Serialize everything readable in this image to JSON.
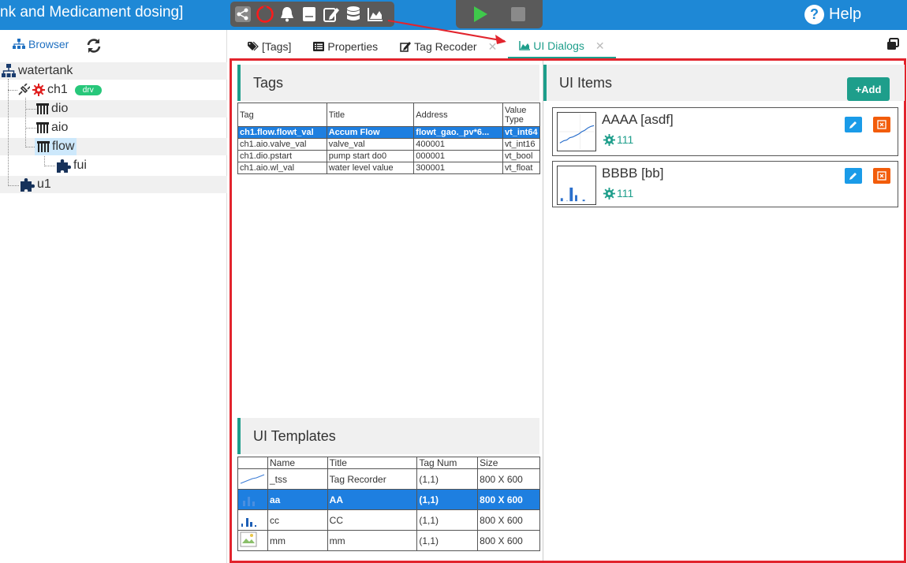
{
  "app": {
    "title": "nk and Medicament dosing]",
    "help_label": "Help"
  },
  "toolbar": {
    "icons": [
      "share-icon",
      "power-icon",
      "bell-icon",
      "book-icon",
      "edit-icon",
      "database-icon",
      "area-chart-icon"
    ],
    "run": [
      "play-icon",
      "stop-icon"
    ]
  },
  "browser": {
    "label": "Browser",
    "tree": [
      {
        "label": "watertank"
      },
      {
        "label": "ch1",
        "badge": "drv"
      },
      {
        "label": "dio"
      },
      {
        "label": "aio"
      },
      {
        "label": "flow"
      },
      {
        "label": "fui"
      },
      {
        "label": "u1"
      }
    ]
  },
  "tabs": [
    {
      "label": "[Tags]"
    },
    {
      "label": "Properties"
    },
    {
      "label": "Tag Recoder"
    },
    {
      "label": "UI Dialogs"
    }
  ],
  "tags": {
    "title": "Tags",
    "headers": [
      "Tag",
      "Title",
      "Address",
      "Value Type"
    ],
    "rows": [
      [
        "ch1.flow.flowt_val",
        "Accum Flow",
        "flowt_gao._pv*6...",
        "vt_int64"
      ],
      [
        "ch1.aio.valve_val",
        "valve_val",
        "400001",
        "vt_int16"
      ],
      [
        "ch1.dio.pstart",
        "pump start do0",
        "000001",
        "vt_bool"
      ],
      [
        "ch1.aio.wl_val",
        "water level value",
        "300001",
        "vt_float"
      ]
    ]
  },
  "templates": {
    "title": "UI Templates",
    "headers": [
      "",
      "Name",
      "Title",
      "Tag Num",
      "Size"
    ],
    "rows": [
      [
        "_tss",
        "Tag Recorder",
        "(1,1)",
        "800 X 600"
      ],
      [
        "aa",
        "AA",
        "(1,1)",
        "800 X 600"
      ],
      [
        "cc",
        "CC",
        "(1,1)",
        "800 X 600"
      ],
      [
        "mm",
        "mm",
        "(1,1)",
        "800 X 600"
      ]
    ]
  },
  "ui_items": {
    "title": "UI Items",
    "add_label": "+Add",
    "items": [
      {
        "title": "AAAA [asdf]",
        "count": "111"
      },
      {
        "title": "BBBB [bb]",
        "count": "111"
      }
    ]
  },
  "colors": {
    "topbar": "#1e88d6",
    "accent": "#1e9e8b",
    "selection": "#1e7fe0",
    "frame": "#e2242d"
  }
}
